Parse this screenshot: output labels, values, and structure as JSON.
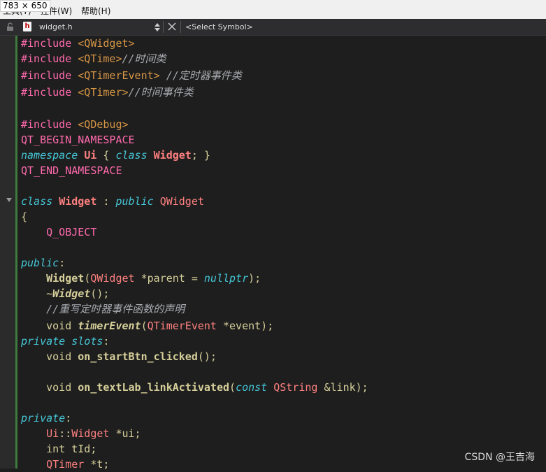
{
  "size_badge": "783 × 650",
  "menu": {
    "items": [
      "工具(T)",
      "控件(W)",
      "帮助(H)"
    ]
  },
  "toolbar": {
    "file_icon_letter": "h",
    "file_name": "widget.h",
    "symbol_placeholder": "<Select Symbol>"
  },
  "code_lines": [
    [
      {
        "t": "#include ",
        "c": "pp"
      },
      {
        "t": "<QWidget>",
        "c": "inc"
      }
    ],
    [
      {
        "t": "#include ",
        "c": "pp"
      },
      {
        "t": "<QTime>",
        "c": "inc"
      },
      {
        "t": "//时间类",
        "c": "cm"
      }
    ],
    [
      {
        "t": "#include ",
        "c": "pp"
      },
      {
        "t": "<QTimerEvent>",
        "c": "inc"
      },
      {
        "t": " //定时器事件类",
        "c": "cm"
      }
    ],
    [
      {
        "t": "#include ",
        "c": "pp"
      },
      {
        "t": "<QTimer>",
        "c": "inc"
      },
      {
        "t": "//时间事件类",
        "c": "cm"
      }
    ],
    [],
    [
      {
        "t": "#include ",
        "c": "pp"
      },
      {
        "t": "<QDebug>",
        "c": "inc"
      }
    ],
    [
      {
        "t": "QT_BEGIN_NAMESPACE",
        "c": "mac"
      }
    ],
    [
      {
        "t": "namespace",
        "c": "kw"
      },
      {
        "t": " ",
        "c": "plain"
      },
      {
        "t": "Ui",
        "c": "cls"
      },
      {
        "t": " { ",
        "c": "pun"
      },
      {
        "t": "class",
        "c": "kw"
      },
      {
        "t": " ",
        "c": "plain"
      },
      {
        "t": "Widget",
        "c": "cls"
      },
      {
        "t": "; }",
        "c": "pun"
      }
    ],
    [
      {
        "t": "QT_END_NAMESPACE",
        "c": "mac"
      }
    ],
    [],
    [
      {
        "t": "class",
        "c": "kw"
      },
      {
        "t": " ",
        "c": "plain"
      },
      {
        "t": "Widget",
        "c": "cls"
      },
      {
        "t": " : ",
        "c": "pun"
      },
      {
        "t": "public",
        "c": "kw"
      },
      {
        "t": " ",
        "c": "plain"
      },
      {
        "t": "QWidget",
        "c": "type"
      }
    ],
    [
      {
        "t": "{",
        "c": "pun"
      }
    ],
    [
      {
        "t": "    ",
        "c": "plain"
      },
      {
        "t": "Q_OBJECT",
        "c": "mac"
      }
    ],
    [],
    [
      {
        "t": "public",
        "c": "kw"
      },
      {
        "t": ":",
        "c": "pun"
      }
    ],
    [
      {
        "t": "    ",
        "c": "plain"
      },
      {
        "t": "Widget",
        "c": "fn"
      },
      {
        "t": "(",
        "c": "pun"
      },
      {
        "t": "QWidget",
        "c": "type"
      },
      {
        "t": " *parent = ",
        "c": "plain"
      },
      {
        "t": "nullptr",
        "c": "kw"
      },
      {
        "t": ");",
        "c": "pun"
      }
    ],
    [
      {
        "t": "    ~",
        "c": "plain"
      },
      {
        "t": "Widget",
        "c": "fni"
      },
      {
        "t": "();",
        "c": "pun"
      }
    ],
    [
      {
        "t": "    ",
        "c": "plain"
      },
      {
        "t": "//重写定时器事件函数的声明",
        "c": "cm"
      }
    ],
    [
      {
        "t": "    void ",
        "c": "plain"
      },
      {
        "t": "timerEvent",
        "c": "fni"
      },
      {
        "t": "(",
        "c": "pun"
      },
      {
        "t": "QTimerEvent",
        "c": "type"
      },
      {
        "t": " *event);",
        "c": "plain"
      }
    ],
    [
      {
        "t": "private slots",
        "c": "kw"
      },
      {
        "t": ":",
        "c": "pun"
      }
    ],
    [
      {
        "t": "    void ",
        "c": "plain"
      },
      {
        "t": "on_startBtn_clicked",
        "c": "fn"
      },
      {
        "t": "();",
        "c": "pun"
      }
    ],
    [],
    [
      {
        "t": "    void ",
        "c": "plain"
      },
      {
        "t": "on_textLab_linkActivated",
        "c": "fn"
      },
      {
        "t": "(",
        "c": "pun"
      },
      {
        "t": "const",
        "c": "kw"
      },
      {
        "t": " ",
        "c": "plain"
      },
      {
        "t": "QString",
        "c": "type"
      },
      {
        "t": " &link);",
        "c": "plain"
      }
    ],
    [],
    [
      {
        "t": "private",
        "c": "kw"
      },
      {
        "t": ":",
        "c": "pun"
      }
    ],
    [
      {
        "t": "    ",
        "c": "plain"
      },
      {
        "t": "Ui",
        "c": "type"
      },
      {
        "t": "::",
        "c": "pun"
      },
      {
        "t": "Widget",
        "c": "type"
      },
      {
        "t": " *ui;",
        "c": "plain"
      }
    ],
    [
      {
        "t": "    int tId;",
        "c": "plain"
      }
    ],
    [
      {
        "t": "    ",
        "c": "plain"
      },
      {
        "t": "QTimer",
        "c": "type"
      },
      {
        "t": " *t;",
        "c": "plain"
      }
    ]
  ],
  "watermark": "CSDN @王吉海"
}
